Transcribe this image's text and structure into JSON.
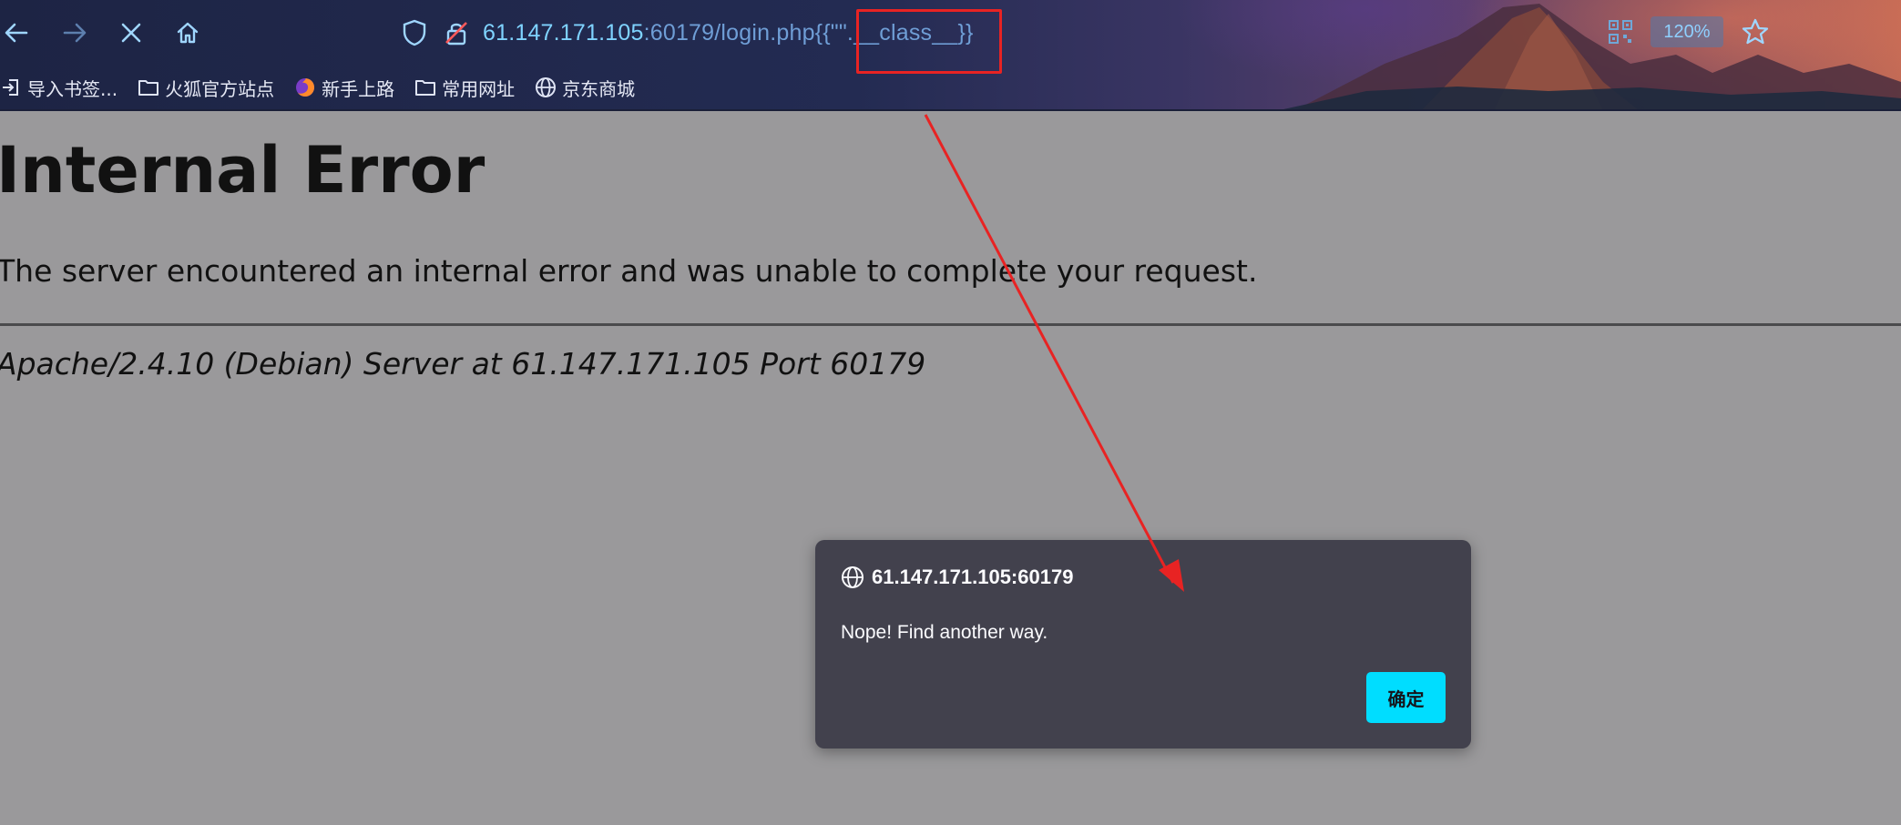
{
  "browser": {
    "url": {
      "host": "61.147.171.105",
      "rest": ":60179/login.php{{\"\".__class__}}"
    },
    "zoom": "120%",
    "icons": {
      "back": "back-arrow-icon",
      "forward": "forward-arrow-icon",
      "stop": "close-icon",
      "home": "home-icon",
      "shield": "shield-icon",
      "insecure": "insecure-lock-icon",
      "qr": "qr-code-icon",
      "bookmark_star": "star-icon"
    },
    "bookmarks": [
      {
        "label": "导入书签...",
        "icon": "import-icon"
      },
      {
        "label": "火狐官方站点",
        "icon": "folder-icon"
      },
      {
        "label": "新手上路",
        "icon": "firefox-icon"
      },
      {
        "label": "常用网址",
        "icon": "folder-icon"
      },
      {
        "label": "京东商城",
        "icon": "globe-icon"
      }
    ]
  },
  "page": {
    "title": "Internal Error",
    "message": "The server encountered an internal error and was unable to complete your request.",
    "server_signature": "Apache/2.4.10 (Debian) Server at 61.147.171.105 Port 60179"
  },
  "dialog": {
    "origin": "61.147.171.105:60179",
    "message": "Nope! Find another way.",
    "ok_label": "确定"
  },
  "annotation": {
    "color": "#e82323"
  },
  "colors": {
    "accent": "#00ddff",
    "dialog_bg": "#42414d",
    "page_bg": "#9a999b"
  }
}
